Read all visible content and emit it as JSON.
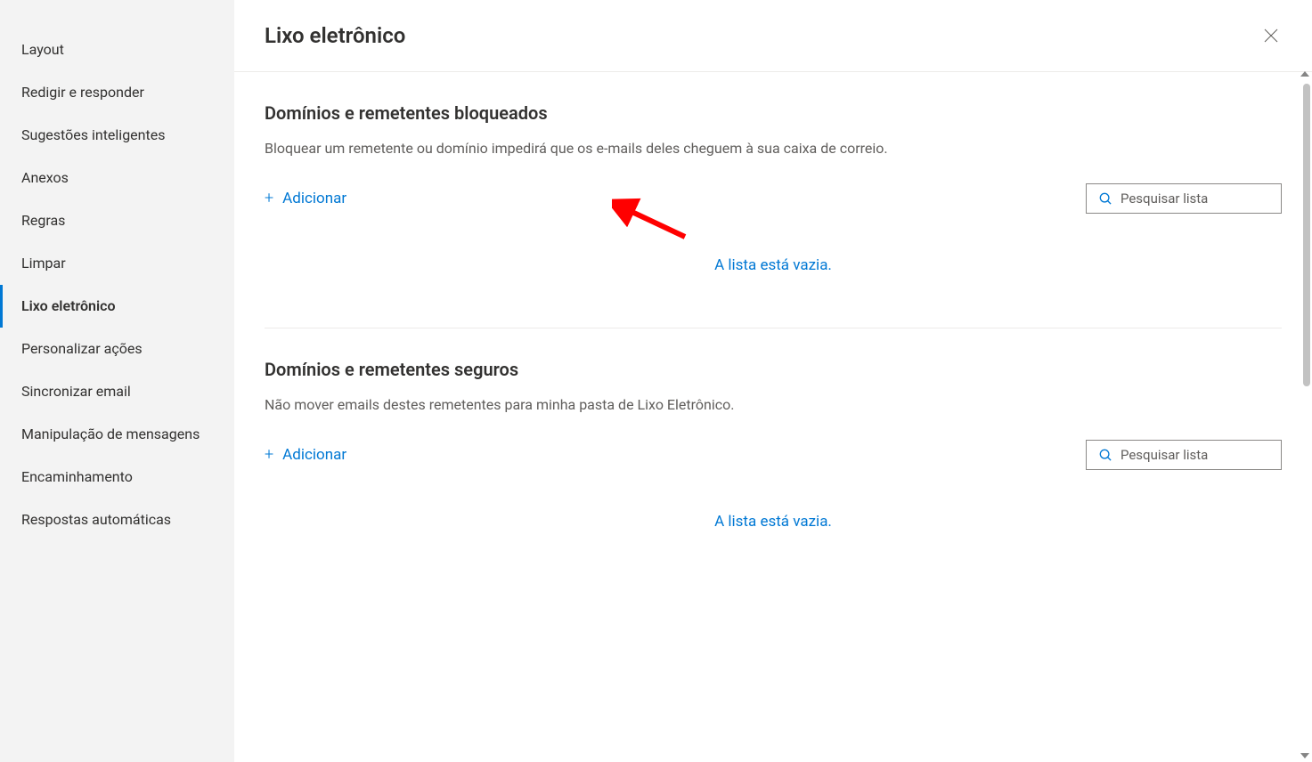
{
  "sidebar": {
    "items": [
      {
        "label": "Layout"
      },
      {
        "label": "Redigir e responder"
      },
      {
        "label": "Sugestões inteligentes"
      },
      {
        "label": "Anexos"
      },
      {
        "label": "Regras"
      },
      {
        "label": "Limpar"
      },
      {
        "label": "Lixo eletrônico",
        "active": true
      },
      {
        "label": "Personalizar ações"
      },
      {
        "label": "Sincronizar email"
      },
      {
        "label": "Manipulação de mensagens"
      },
      {
        "label": "Encaminhamento"
      },
      {
        "label": "Respostas automáticas"
      }
    ]
  },
  "header": {
    "title": "Lixo eletrônico"
  },
  "sections": {
    "blocked": {
      "title": "Domínios e remetentes bloqueados",
      "description": "Bloquear um remetente ou domínio impedirá que os e-mails deles cheguem à sua caixa de correio.",
      "add_label": "Adicionar",
      "search_placeholder": "Pesquisar lista",
      "empty_message": "A lista está vazia."
    },
    "safe": {
      "title": "Domínios e remetentes seguros",
      "description": "Não mover emails destes remetentes para minha pasta de Lixo Eletrônico.",
      "add_label": "Adicionar",
      "search_placeholder": "Pesquisar lista",
      "empty_message": "A lista está vazia."
    }
  }
}
